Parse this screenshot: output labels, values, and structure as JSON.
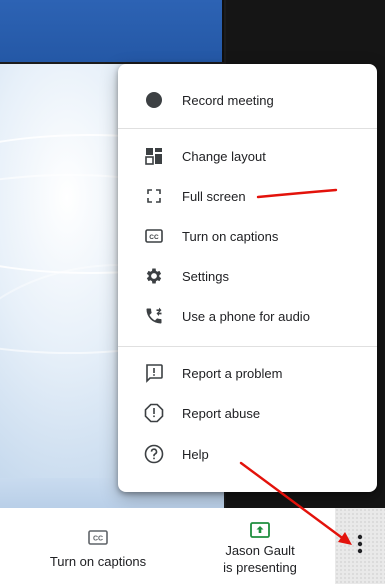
{
  "menu": {
    "items": [
      {
        "label": "Record meeting",
        "icon": "record-icon"
      },
      {
        "label": "Change layout",
        "icon": "layout-icon"
      },
      {
        "label": "Full screen",
        "icon": "fullscreen-icon"
      },
      {
        "label": "Turn on captions",
        "icon": "captions-icon"
      },
      {
        "label": "Settings",
        "icon": "settings-icon"
      },
      {
        "label": "Use a phone for audio",
        "icon": "phone-audio-icon"
      },
      {
        "label": "Report a problem",
        "icon": "report-problem-icon"
      },
      {
        "label": "Report abuse",
        "icon": "report-abuse-icon"
      },
      {
        "label": "Help",
        "icon": "help-icon"
      }
    ]
  },
  "bottombar": {
    "captions_label": "Turn on captions",
    "captions_icon": "cc-icon",
    "presenter_line1": "Jason Gault",
    "presenter_line2": "is presenting",
    "presenting_icon": "present-screen-icon",
    "more_icon": "more-vert-icon"
  },
  "annotations": {
    "underline_color": "#e3120b",
    "arrow_color": "#e3120b"
  },
  "colors": {
    "slide_top_blue": "#2458a6",
    "presenting_green": "#1e8e3e"
  }
}
